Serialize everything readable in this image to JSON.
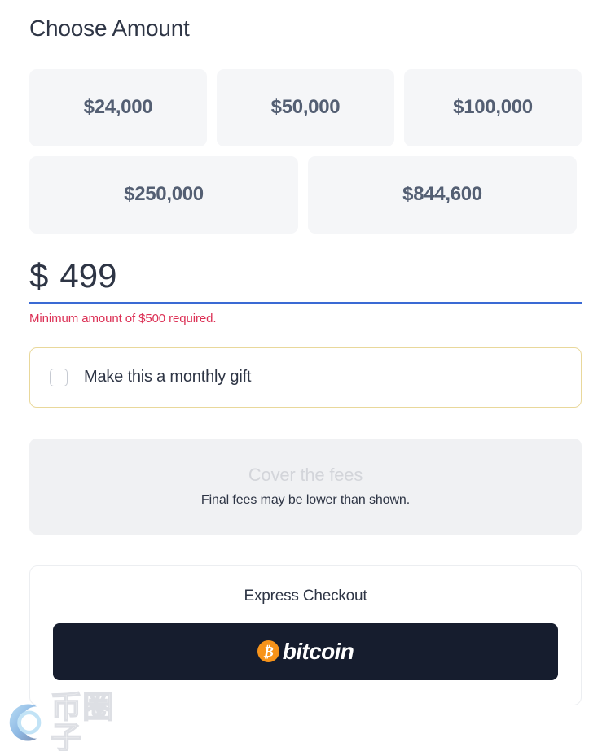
{
  "header": {
    "title": "Choose Amount"
  },
  "amounts": {
    "row1": [
      {
        "label": "$24,000",
        "name": "amount-24000"
      },
      {
        "label": "$50,000",
        "name": "amount-50000"
      },
      {
        "label": "$100,000",
        "name": "amount-100000"
      }
    ],
    "row2": [
      {
        "label": "$250,000",
        "name": "amount-250000"
      },
      {
        "label": "$844,600",
        "name": "amount-844600"
      }
    ]
  },
  "custom_amount": {
    "currency_symbol": "$",
    "value": "499",
    "placeholder": "0",
    "error": "Minimum amount of $500 required.",
    "underline_color": "#3a6ad4",
    "error_color": "#dc3055"
  },
  "monthly_gift": {
    "label": "Make this a monthly gift",
    "checked": false,
    "border_color": "#e9d89b"
  },
  "fees": {
    "title": "Cover the fees",
    "subtitle": "Final fees may be lower than shown.",
    "title_color": "#d3d5da",
    "panel_color": "#f0f1f3"
  },
  "express_checkout": {
    "title": "Express Checkout",
    "bitcoin_button": {
      "symbol": "₿",
      "label": "bitcoin",
      "background": "#161d2e",
      "badge_color": "#f7931a"
    }
  },
  "watermark": {
    "text": "币圈子"
  }
}
